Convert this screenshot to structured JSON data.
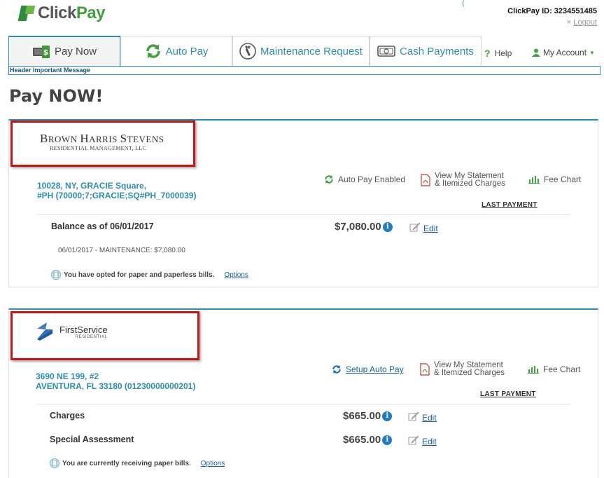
{
  "header": {
    "brand_click": "Click",
    "brand_pay": "Pay",
    "clickpay_id_label": "ClickPay ID: 3234551485",
    "logout_label": "Logout",
    "logout_x": "×",
    "tiny_mark": "("
  },
  "tabs": [
    {
      "label": "Pay Now",
      "icon": "money-icon",
      "active": true
    },
    {
      "label": "Auto Pay",
      "icon": "refresh-icon",
      "active": false
    },
    {
      "label": "Maintenance Request",
      "icon": "wrench-icon",
      "active": false
    },
    {
      "label": "Cash Payments",
      "icon": "cash-icon",
      "active": false
    }
  ],
  "help_label": "Help",
  "my_account_label": "My Account",
  "header_message": "Header Important Message",
  "page_title": "Pay NOW!",
  "cards": [
    {
      "company_name_parts": [
        "B",
        "ROWN ",
        "H",
        "ARRIS ",
        "S",
        "TEVENS"
      ],
      "company_sub": "RESIDENTIAL MANAGEMENT, LLC",
      "address_line1": "10028, NY, GRACIE Square,",
      "address_line2": "#PH (70000;7;GRACIE;SQ#PH_7000039)",
      "autopay_label": "Auto Pay Enabled",
      "statement_line1": "View My Statement",
      "statement_line2": "& Itemized Charges",
      "fee_chart_label": "Fee Chart",
      "last_payment_label": "LAST PAYMENT",
      "rows": [
        {
          "label": "Balance as of 06/01/2017",
          "amount": "$7,080.00",
          "edit_label": "Edit"
        }
      ],
      "detail": "06/01/2017 - MAINTENANCE: $7,080.00",
      "bill_note": "You have opted for paper and paperless bills.",
      "options_label": "Options"
    },
    {
      "company_name": "FirstService",
      "company_sub": "RESIDENTIAL",
      "address_line1": "3690 NE 199, #2",
      "address_line2": "AVENTURA, FL 33180 (01230000000201)",
      "autopay_label": "Setup Auto Pay",
      "statement_line1": "View My Statement",
      "statement_line2": "& Itemized Charges",
      "fee_chart_label": "Fee Chart",
      "last_payment_label": "LAST PAYMENT",
      "rows": [
        {
          "label": "Charges",
          "amount": "$665.00",
          "edit_label": "Edit"
        },
        {
          "label": "Special Assessment",
          "amount": "$665.00",
          "edit_label": "Edit"
        }
      ],
      "bill_note": "You are currently receiving paper bills.",
      "options_label": "Options"
    }
  ],
  "colors": {
    "accent": "#2a8fb0",
    "link": "#1a5fa8",
    "brand_green": "#3f9f3f",
    "highlight_red": "#cc1111"
  }
}
